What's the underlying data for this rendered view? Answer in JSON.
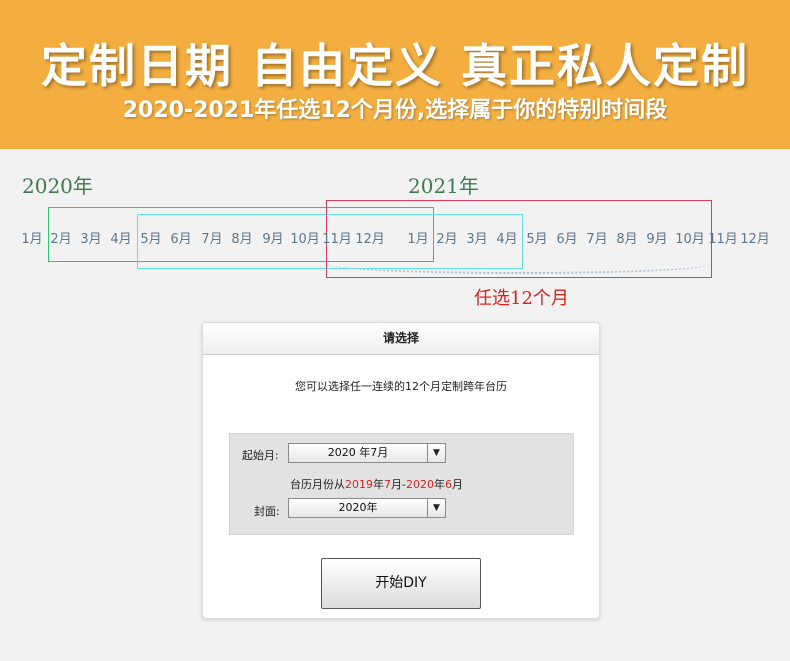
{
  "banner": {
    "title": "定制日期  自由定义  真正私人定制",
    "subtitle": "2020-2021年任选12个月份,选择属于你的特别时间段"
  },
  "timeline": {
    "year1": "2020年",
    "year2": "2021年",
    "months_2020": [
      "1月",
      "2月",
      "3月",
      "4月",
      "5月",
      "6月",
      "7月",
      "8月",
      "9月",
      "10月",
      "11月",
      "12月"
    ],
    "months_2021": [
      "1月",
      "2月",
      "3月",
      "4月",
      "5月",
      "6月",
      "7月",
      "8月",
      "9月",
      "10月",
      "11月",
      "12月"
    ],
    "pick_label": "任选12个月"
  },
  "dialog": {
    "title": "请选择",
    "description": "您可以选择任一连续的12个月定制跨年台历",
    "start_month_label": "起始月:",
    "start_month_value": "2020 年7月",
    "range": {
      "prefix": "台历月份从",
      "from_year": "2019",
      "year_char1": "年",
      "from_month": "7",
      "sep": "月-",
      "to_year": "2020",
      "year_char2": "年",
      "to_month": "6",
      "suffix": "月"
    },
    "cover_label": "封面:",
    "cover_value": "2020年",
    "start_button": "开始DIY"
  },
  "colors": {
    "banner": "#f3ae3f",
    "year_text": "#3d7a4c",
    "highlight_red": "#e0201c",
    "box_green": "#35c46c",
    "box_cyan": "#5fe0e6",
    "box_red": "#e03a5c"
  }
}
